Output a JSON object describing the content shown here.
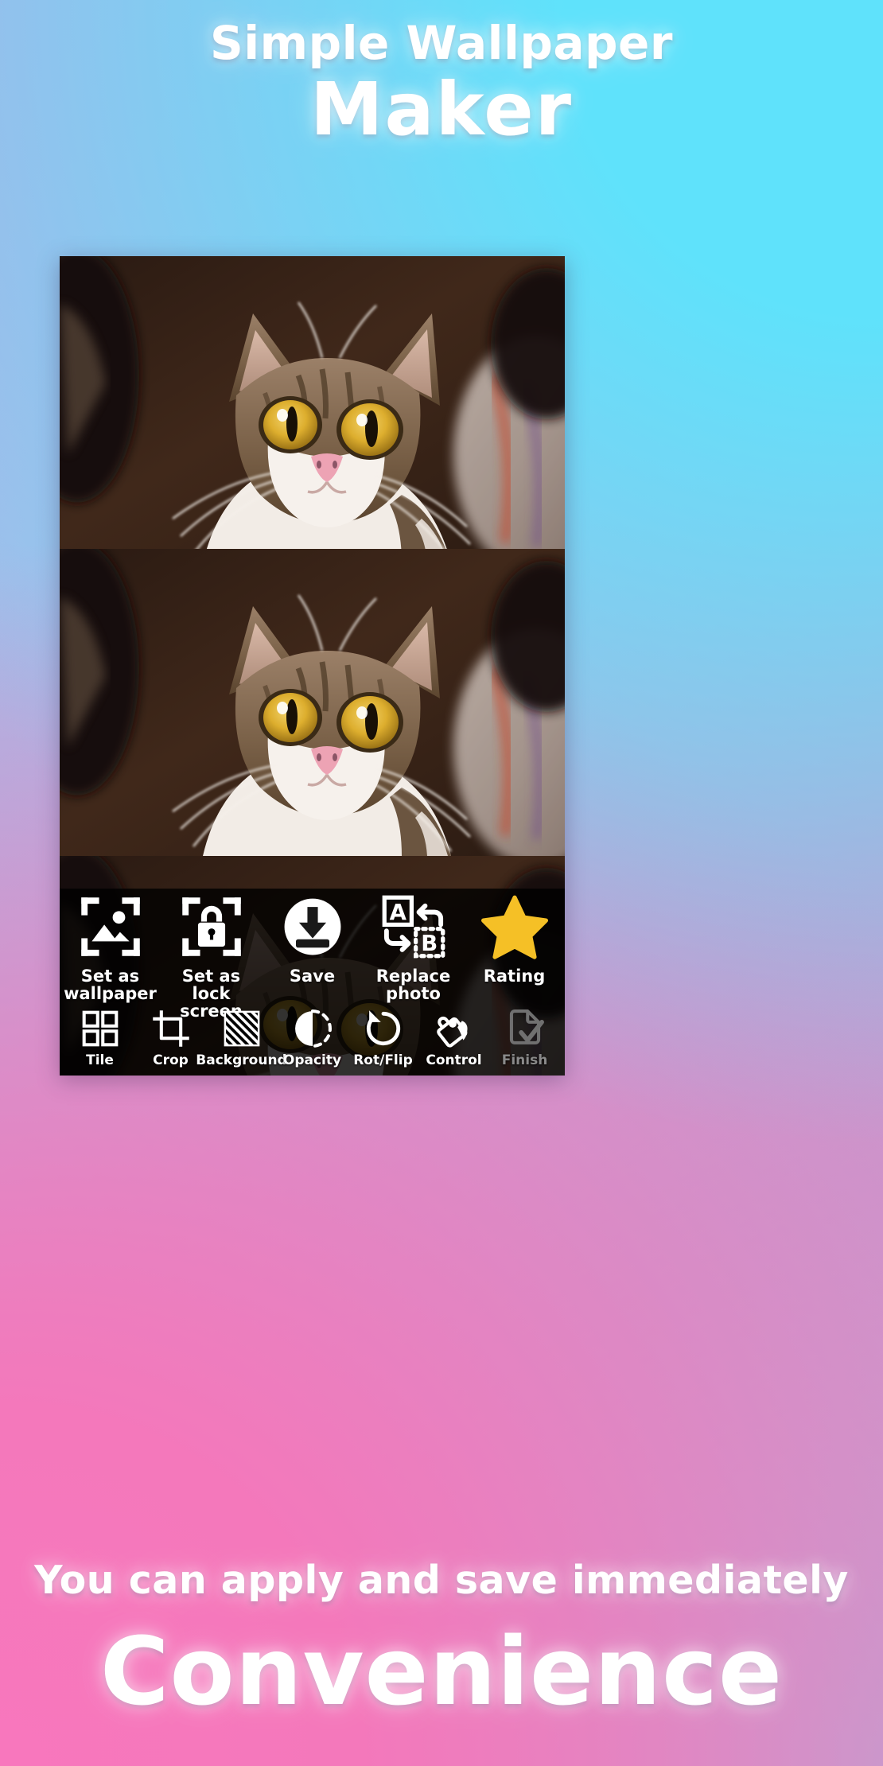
{
  "promo": {
    "title_line1": "Simple Wallpaper",
    "title_line2": "Maker",
    "subtitle_line1": "You can apply and save immediately",
    "subtitle_line2": "Convenience"
  },
  "colors": {
    "bg_top_left": "#aeb4e6",
    "bg_top_right": "#5fe2fb",
    "bg_bottom_left": "#f478bb",
    "bg_bottom_right": "#b1abd6",
    "headline_text": "#ffffff",
    "toolbar_bg": "#000000",
    "toolbar_text": "#ffffff",
    "rating_star": "#f5c026",
    "disabled_text": "#8a8a8a",
    "photo_backdrop": "#3a2419"
  },
  "preview": {
    "panes": [
      {
        "name": "wallpaper-preview-top"
      },
      {
        "name": "wallpaper-preview-middle"
      },
      {
        "name": "wallpaper-preview-bottom"
      }
    ]
  },
  "toolbar": {
    "primary_actions": [
      {
        "icon": "set-as-wallpaper-icon",
        "label_line1": "Set as",
        "label_line2": "wallpaper",
        "enabled": true
      },
      {
        "icon": "set-as-lock-screen-icon",
        "label_line1": "Set as",
        "label_line2": "lock screen",
        "enabled": true
      },
      {
        "icon": "save-icon",
        "label_line1": "Save",
        "label_line2": "",
        "enabled": true
      },
      {
        "icon": "replace-photo-icon",
        "label_line1": "Replace",
        "label_line2": "photo",
        "enabled": true
      },
      {
        "icon": "rating-star-icon",
        "label_line1": "Rating",
        "label_line2": "",
        "enabled": true
      }
    ],
    "secondary_actions": [
      {
        "icon": "tile-icon",
        "label": "Tile",
        "enabled": true
      },
      {
        "icon": "crop-icon",
        "label": "Crop",
        "enabled": true
      },
      {
        "icon": "background-icon",
        "label": "Background",
        "enabled": true
      },
      {
        "icon": "opacity-icon",
        "label": "Opacity",
        "enabled": true
      },
      {
        "icon": "rotate-flip-icon",
        "label": "Rot/Flip",
        "enabled": true
      },
      {
        "icon": "control-icon",
        "label": "Control",
        "enabled": true
      },
      {
        "icon": "finish-icon",
        "label": "Finish",
        "enabled": false
      }
    ],
    "replace_photo_labels": {
      "source": "A",
      "target": "B"
    }
  }
}
